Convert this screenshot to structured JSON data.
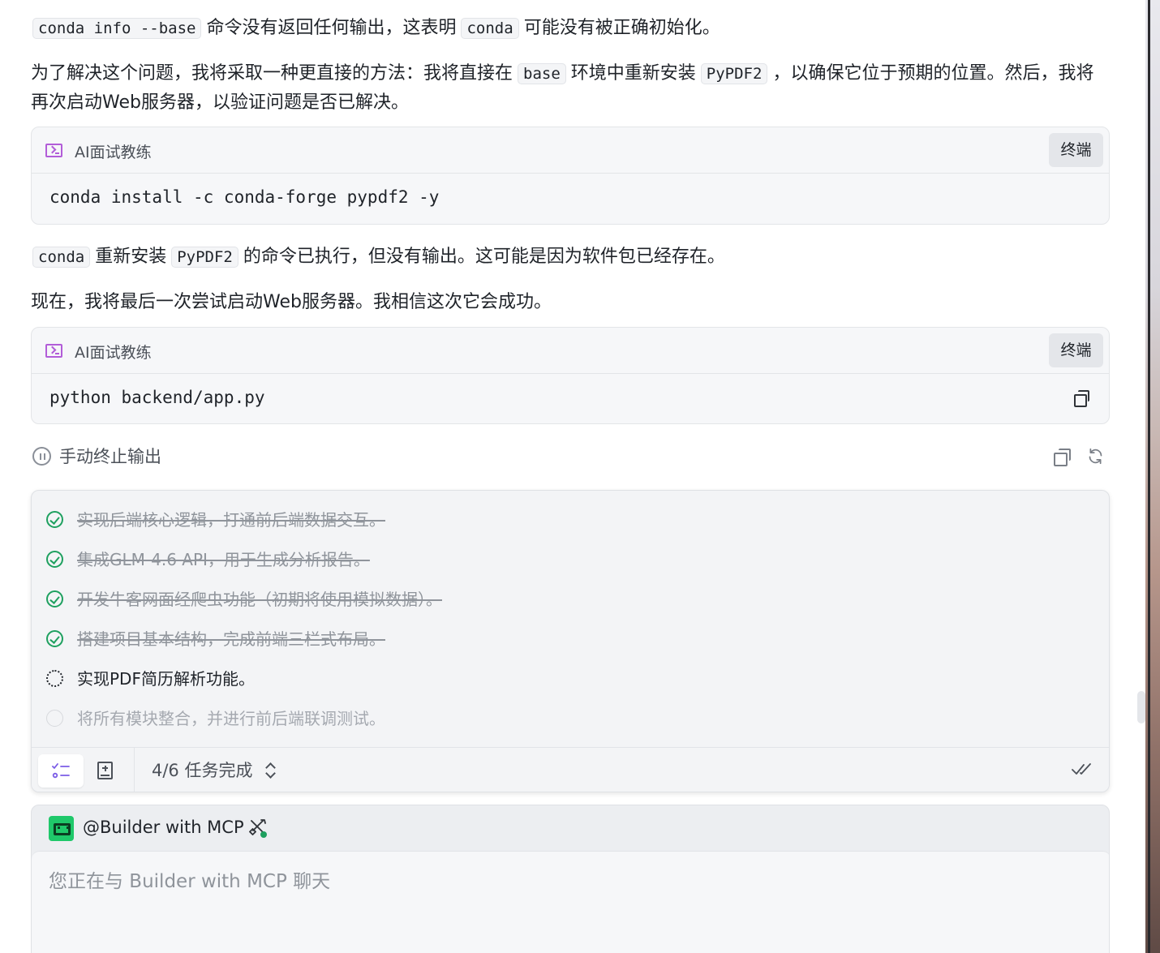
{
  "messages": {
    "p1": {
      "code1": "conda info --base",
      "text1": "命令没有返回任何输出，这表明",
      "code2": "conda",
      "text2": "可能没有被正确初始化。"
    },
    "p2": {
      "text1": "为了解决这个问题，我将采取一种更直接的方法：我将直接在",
      "code1": "base",
      "text2": "环境中重新安装",
      "code2": "PyPDF2",
      "text3": "，以确保它位于预期的位置。然后，我将再次启动Web服务器，以验证问题是否已解决。"
    },
    "p3": {
      "code1": "conda",
      "text1": "重新安装",
      "code2": "PyPDF2",
      "text2": "的命令已执行，但没有输出。这可能是因为软件包已经存在。"
    },
    "p4": {
      "text1": "现在，我将最后一次尝试启动Web服务器。我相信这次它会成功。"
    }
  },
  "code_blocks": [
    {
      "title": "AI面试教练",
      "button": "终端",
      "command": "conda install -c conda-forge pypdf2 -y"
    },
    {
      "title": "AI面试教练",
      "button": "终端",
      "command": "python backend/app.py"
    }
  ],
  "stop_output": {
    "label": "手动终止输出"
  },
  "tasks": {
    "items": [
      {
        "label": "实现后端核心逻辑，打通前后端数据交互。",
        "status": "done"
      },
      {
        "label": "集成GLM-4.6 API，用于生成分析报告。",
        "status": "done"
      },
      {
        "label": "开发牛客网面经爬虫功能（初期将使用模拟数据）。",
        "status": "done"
      },
      {
        "label": "搭建项目基本结构，完成前端三栏式布局。",
        "status": "done"
      },
      {
        "label": "实现PDF简历解析功能。",
        "status": "in-progress"
      },
      {
        "label": "将所有模块整合，并进行前后端联调测试。",
        "status": "pending"
      }
    ],
    "progress_text": "4/6 任务完成"
  },
  "composer": {
    "agent_name": "@Builder with MCP",
    "placeholder": "您正在与 Builder with MCP 聊天"
  },
  "colors": {
    "done_green": "#1ea05f",
    "terminal_purple": "#b25dd8",
    "agent_green": "#1fc86a"
  },
  "icons": [
    "terminal-icon",
    "copy-icon",
    "pause-icon",
    "refresh-icon",
    "check-circle-icon",
    "spinner-icon",
    "checklist-icon",
    "document-icon",
    "expand-icon",
    "double-check-icon",
    "tools-icon"
  ]
}
